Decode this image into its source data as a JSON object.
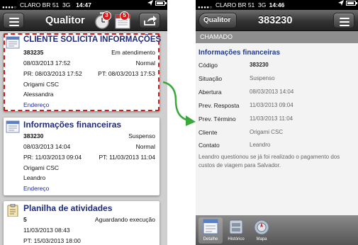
{
  "left_phone": {
    "status": {
      "carrier": "CLARO BR 51",
      "network": "3G",
      "time": "14:47"
    },
    "nav": {
      "title": "Qualitor",
      "stopwatch_badge": "3",
      "calendar_badge": "5",
      "icons": [
        "menu-icon",
        "stopwatch-icon",
        "calendar-icon",
        "share-icon"
      ]
    },
    "cards": [
      {
        "title": "CLIENTE SOLICITA INFORMAÇÕES",
        "number": "383235",
        "status": "Em atendimento",
        "date": "08/03/2013 17:52",
        "priority": "Normal",
        "pr": "PR: 08/03/2013 17:52",
        "pt": "PT: 08/03/2013 17:53",
        "company": "Origami CSC",
        "contact": "Alessandra",
        "link": "Endereço"
      },
      {
        "title": "Informações financeiras",
        "number": "383230",
        "status": "Suspenso",
        "date": "08/03/2013 14:04",
        "priority": "Normal",
        "pr": "PR: 11/03/2013 09:04",
        "pt": "PT: 11/03/2013 11:04",
        "company": "Origami CSC",
        "contact": "Leandro",
        "link": "Endereço"
      },
      {
        "title": "Planilha de atividades",
        "number": "5",
        "status": "Aguardando execução",
        "date": "11/03/2013 08:43",
        "pt": "PT: 15/03/2013 18:00"
      }
    ]
  },
  "right_phone": {
    "status": {
      "carrier": "CLARO BR 51",
      "network": "3G",
      "time": "14:46"
    },
    "nav": {
      "back_label": "Qualitor",
      "title": "383230",
      "icons": [
        "menu-icon"
      ]
    },
    "header": "CHAMADO",
    "section_title": "Informações financeiras",
    "rows": [
      {
        "label": "Código",
        "value": "383230"
      },
      {
        "label": "Situação",
        "value": "Suspenso"
      },
      {
        "label": "Abertura",
        "value": "08/03/2013 14:04"
      },
      {
        "label": "Prev. Resposta",
        "value": "11/03/2013 09:04"
      },
      {
        "label": "Prev. Término",
        "value": "11/03/2013 11:04"
      },
      {
        "label": "Cliente",
        "value": "Origami CSC"
      },
      {
        "label": "Contato",
        "value": "Leandro"
      }
    ],
    "description": "Leandro questionou se já foi realizado o pagamento dos custos de viagem para Salvador.",
    "tabs": [
      {
        "label": "Detalhe",
        "icon": "detail-icon",
        "active": true
      },
      {
        "label": "Histórico",
        "icon": "history-icon",
        "active": false
      },
      {
        "label": "Mapa",
        "icon": "map-icon",
        "active": false
      }
    ]
  },
  "colors": {
    "title_blue": "#1f2a78",
    "link_blue": "#1f2a9e",
    "selection_red": "#cc1b1b",
    "arrow_green": "#3aa83a",
    "badge_red": "#d51a1a"
  }
}
